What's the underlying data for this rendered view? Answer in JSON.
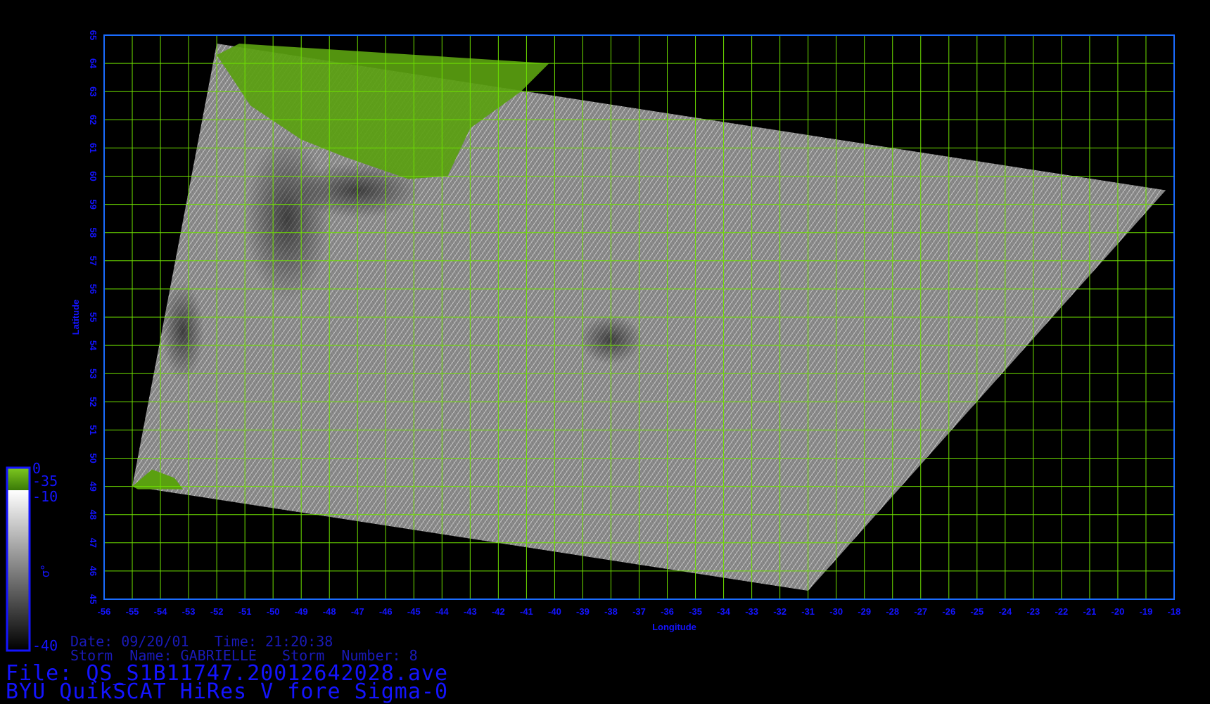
{
  "map": {
    "lon_range": [
      -56,
      -18
    ],
    "lat_range": [
      45,
      65
    ],
    "grid_color": "#6ee000",
    "frame_color": "#1a6cff",
    "axis_label_color": "#1414ff",
    "x_axis_label": "Longitude",
    "y_axis_label": "Latitude",
    "x_ticks": [
      "-56",
      "-55",
      "-54",
      "-53",
      "-52",
      "-51",
      "-50",
      "-49",
      "-48",
      "-47",
      "-46",
      "-45",
      "-44",
      "-43",
      "-42",
      "-41",
      "-40",
      "-39",
      "-38",
      "-37",
      "-36",
      "-35",
      "-34",
      "-33",
      "-32",
      "-31",
      "-30",
      "-29",
      "-28",
      "-27",
      "-26",
      "-25",
      "-24",
      "-23",
      "-22",
      "-21",
      "-20",
      "-19",
      "-18"
    ],
    "y_ticks": [
      "45",
      "46",
      "47",
      "48",
      "49",
      "50",
      "51",
      "52",
      "53",
      "54",
      "55",
      "56",
      "57",
      "58",
      "59",
      "60",
      "61",
      "62",
      "63",
      "64",
      "65"
    ],
    "swath_corners": [
      [
        -52,
        64.7
      ],
      [
        -18.3,
        59.5
      ],
      [
        -31,
        45.3
      ],
      [
        -55,
        49
      ]
    ],
    "land_color": "#5aa010"
  },
  "colorbar": {
    "label": "σ°",
    "ticks": [
      "0",
      "-35",
      "-10",
      "-40"
    ],
    "land_color": "#5aa010",
    "frame_color": "#1414ff"
  },
  "info": {
    "date_line": "Date: 09/20/01   Time: 21:20:38",
    "storm_line": "Storm  Name: GABRIELLE   Storm  Number: 8",
    "file_line": "File: QS_S1B11747.20012642028.ave",
    "title_line": "BYU QuikSCAT HiRes V fore Sigma-0"
  }
}
